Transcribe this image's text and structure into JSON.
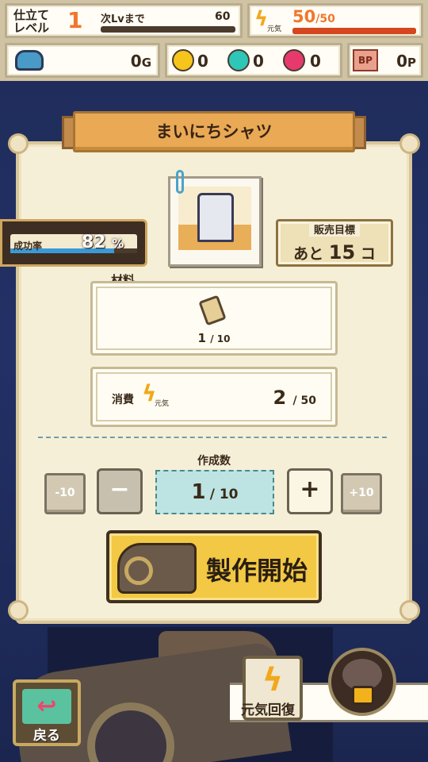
{
  "header": {
    "level_label": "仕立て\nレベル",
    "level_value": "1",
    "next_label": "次Lvまで",
    "next_value": "60",
    "genki_icon_label": "元気",
    "genki_current": "50",
    "genki_max": "/50",
    "gold_value": "0",
    "gold_unit": "G",
    "gem_yellow": "0",
    "gem_teal": "0",
    "gem_pink": "0",
    "bp_icon_label": "BP",
    "bp_value": "0",
    "bp_unit": "P",
    "next_progress": 0.0,
    "genki_progress": 1.0
  },
  "panel": {
    "title": "まいにちシャツ",
    "success_label": "成功率",
    "success_value": "82",
    "success_unit": "%",
    "success_progress": 0.82,
    "sales_title": "販売目標",
    "sales_prefix": "あと",
    "sales_value": "15",
    "sales_suffix": "コ",
    "materials_label": "材料",
    "material_count": "1",
    "material_total": "/ 10",
    "cost_label": "消費",
    "cost_icon_label": "元気",
    "cost_value": "2",
    "cost_total": "/ 50",
    "quantity_label": "作成数",
    "quantity_value": "1",
    "quantity_total": "/ 10",
    "minus10": "-10",
    "minus": "−",
    "plus": "+",
    "plus10": "+10",
    "make_button": "製作開始"
  },
  "footer": {
    "back_label": "戻る",
    "recover_label": "元気回復"
  },
  "colors": {
    "accent_orange": "#f0772c",
    "gem_yellow": "#f5c51c",
    "gem_teal": "#2ec6b8",
    "gem_pink": "#e63a6e",
    "make_button": "#f2c844"
  }
}
